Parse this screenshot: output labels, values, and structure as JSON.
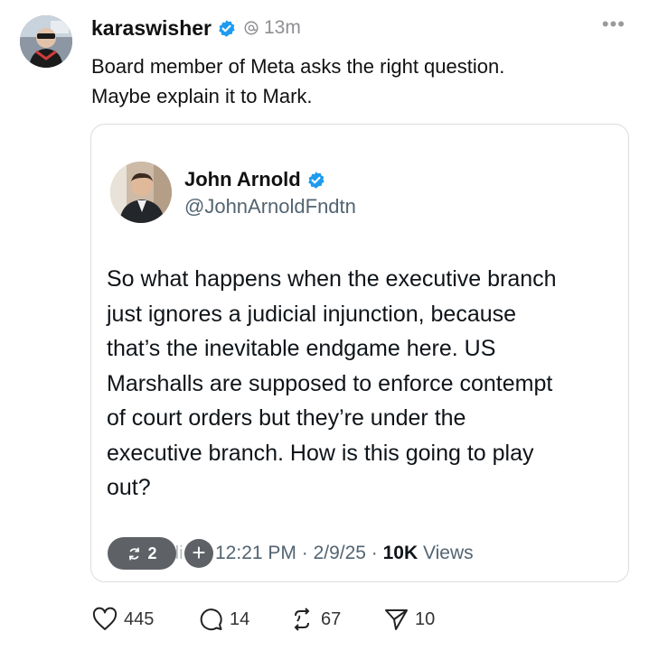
{
  "post": {
    "username": "karaswisher",
    "time": "13m",
    "text_lines": [
      "Board member of Meta asks the right question.",
      "Maybe explain it to Mark."
    ]
  },
  "quote": {
    "name": "John Arnold",
    "handle": "@JohnArnoldFndtn",
    "text_lines": [
      "So what happens when the executive branch",
      "just ignores a judicial injunction, because",
      "that’s the inevitable endgame here. US",
      "Marshalls are supposed to enforce contempt",
      "of court orders but they’re under the",
      "executive branch. How is this going to play",
      "out?"
    ],
    "repost_count": "2",
    "behind_text": "di",
    "time": "12:21 PM",
    "date": "2/9/25",
    "views_count": "10K",
    "views_label": "Views"
  },
  "actions": {
    "likes": "445",
    "replies": "14",
    "reposts": "67",
    "shares": "10"
  },
  "icons": {
    "verified": "verified-badge-icon",
    "thread": "threads-icon",
    "more": "more-icon",
    "like": "heart-icon",
    "reply": "reply-icon",
    "repost": "repost-icon",
    "share": "share-icon"
  },
  "colors": {
    "verified": "#1d9bf0",
    "pill": "#5e6166"
  }
}
